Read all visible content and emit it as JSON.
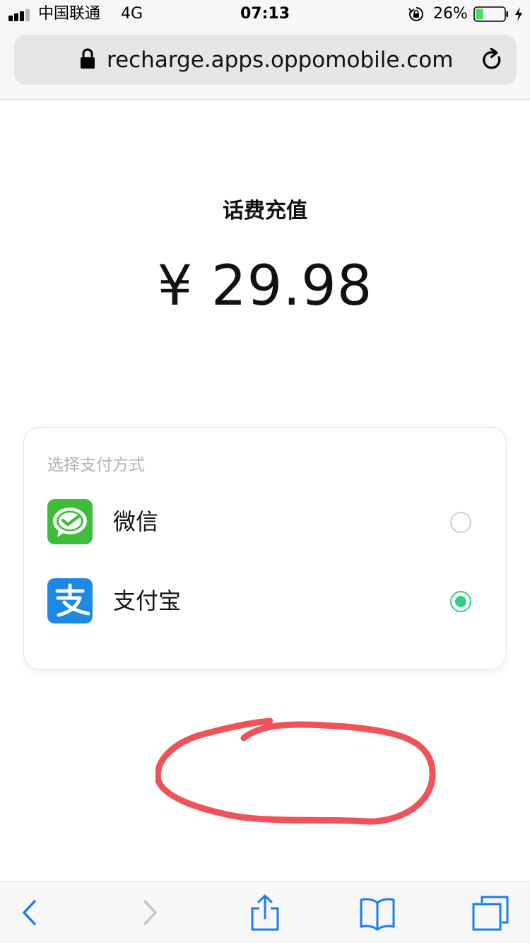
{
  "status_bar": {
    "carrier": "中国联通",
    "network": "4G",
    "time": "07:13",
    "battery_percent": "26%",
    "battery_level": 0.26
  },
  "browser": {
    "url": "recharge.apps.oppomobile.com"
  },
  "main": {
    "title": "话费充值",
    "amount": "¥ 29.98"
  },
  "payment": {
    "caption": "选择支付方式",
    "options": [
      {
        "label": "微信",
        "icon": "wechat-icon",
        "selected": false
      },
      {
        "label": "支付宝",
        "icon": "alipay-icon",
        "selected": true
      }
    ]
  },
  "colors": {
    "accent_green": "#2fcf86",
    "wechat_green": "#3ebd3a",
    "alipay_blue": "#1e88e5",
    "ios_blue": "#1a7cf0",
    "annotation_red": "#f0525a"
  }
}
